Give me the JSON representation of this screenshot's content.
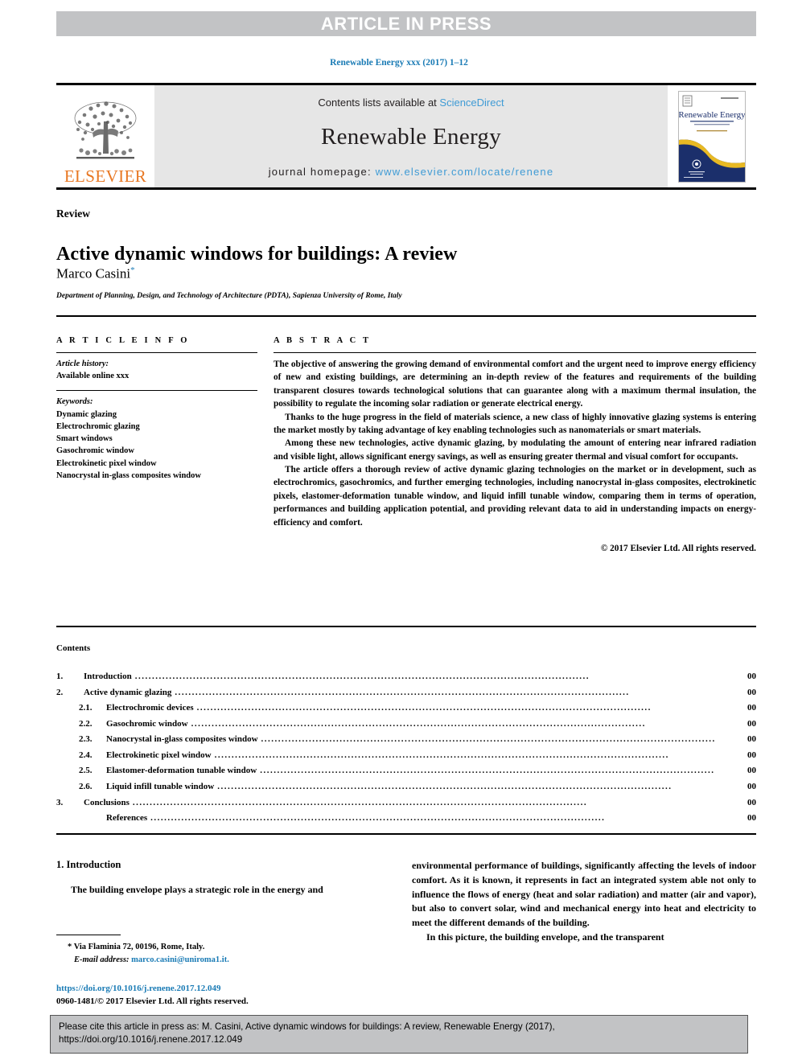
{
  "banner": {
    "text": "ARTICLE IN PRESS"
  },
  "journal_ref": "Renewable Energy xxx (2017) 1–12",
  "masthead": {
    "publisher": "ELSEVIER",
    "contents_prefix": "Contents lists available at ",
    "contents_link": "ScienceDirect",
    "journal_name": "Renewable Energy",
    "homepage_prefix": "journal homepage: ",
    "homepage_url": "www.elsevier.com/locate/renene",
    "cover_title": "Renewable Energy",
    "cover_subtitle": "AN INTERNATIONAL JOURNAL",
    "colors": {
      "elsevier_orange": "#e87722",
      "link_blue": "#3f9bd5",
      "banner_grey": "#c2c3c5",
      "masthead_grey": "#e6e6e6",
      "cover_navy": "#1b2f6b",
      "cover_gold": "#e8b923"
    }
  },
  "article": {
    "type_label": "Review",
    "title": "Active dynamic windows for buildings: A review",
    "author": "Marco Casini",
    "author_marker": "*",
    "affiliation": "Department of Planning, Design, and Technology of Architecture (PDTA), Sapienza University of Rome, Italy"
  },
  "article_info": {
    "heading": "A R T I C L E   I N F O",
    "history_label": "Article history:",
    "history_value": "Available online xxx",
    "keywords_label": "Keywords:",
    "keywords": [
      "Dynamic glazing",
      "Electrochromic glazing",
      "Smart windows",
      "Gasochromic window",
      "Electrokinetic pixel window",
      "Nanocrystal in-glass composites window"
    ]
  },
  "abstract": {
    "heading": "A B S T R A C T",
    "paragraphs": [
      "The objective of answering the growing demand of environmental comfort and the urgent need to improve energy efficiency of new and existing buildings, are determining an in-depth review of the features and requirements of the building transparent closures towards technological solutions that can guarantee along with a maximum thermal insulation, the possibility to regulate the incoming solar radiation or generate electrical energy.",
      "Thanks to the huge progress in the field of materials science, a new class of highly innovative glazing systems is entering the market mostly by taking advantage of key enabling technologies such as nanomaterials or smart materials.",
      "Among these new technologies, active dynamic glazing, by modulating the amount of entering near infrared radiation and visible light, allows significant energy savings, as well as ensuring greater thermal and visual comfort for occupants.",
      "The article offers a thorough review of active dynamic glazing technologies on the market or in development, such as electrochromics, gasochromics, and further emerging technologies, including nanocrystal in-glass composites, electrokinetic pixels, elastomer-deformation tunable window, and liquid infill tunable window, comparing them in terms of operation, performances and building application potential, and providing relevant data to aid in understanding impacts on energy-efficiency and comfort."
    ],
    "copyright": "© 2017 Elsevier Ltd. All rights reserved."
  },
  "contents": {
    "heading": "Contents",
    "entries": [
      {
        "number": "1.",
        "label": "Introduction",
        "page": "00",
        "level": 1
      },
      {
        "number": "2.",
        "label": "Active dynamic glazing",
        "page": "00",
        "level": 1
      },
      {
        "number": "2.1.",
        "label": "Electrochromic devices",
        "page": "00",
        "level": 2
      },
      {
        "number": "2.2.",
        "label": "Gasochromic window",
        "page": "00",
        "level": 2
      },
      {
        "number": "2.3.",
        "label": "Nanocrystal in-glass composites window",
        "page": "00",
        "level": 2
      },
      {
        "number": "2.4.",
        "label": "Electrokinetic pixel window",
        "page": "00",
        "level": 2
      },
      {
        "number": "2.5.",
        "label": "Elastomer-deformation tunable window",
        "page": "00",
        "level": 2
      },
      {
        "number": "2.6.",
        "label": "Liquid infill tunable window",
        "page": "00",
        "level": 2
      },
      {
        "number": "3.",
        "label": "Conclusions",
        "page": "00",
        "level": 1
      },
      {
        "number": "",
        "label": "References",
        "page": "00",
        "level": 2
      }
    ]
  },
  "body": {
    "section_heading": "1.  Introduction",
    "left_column": "The building envelope plays a strategic role in the energy and",
    "right_column_1": "environmental performance of buildings, significantly affecting the levels of indoor comfort. As it is known, it represents in fact an integrated system able not only to influence the flows of energy (heat and solar radiation) and matter (air and vapor), but also to convert solar, wind and mechanical energy into heat and electricity to meet the different demands of the building.",
    "right_column_2": "In this picture, the building envelope, and the transparent"
  },
  "footnote": {
    "marker": "*",
    "address": "Via Flaminia 72, 00196, Rome, Italy.",
    "email_label": "E-mail address:",
    "email": "marco.casini@uniroma1.it.",
    "doi": "https://doi.org/10.1016/j.renene.2017.12.049",
    "issn_line": "0960-1481/© 2017 Elsevier Ltd. All rights reserved."
  },
  "cite_box": {
    "text": "Please cite this article in press as: M. Casini, Active dynamic windows for buildings: A review, Renewable Energy (2017), https://doi.org/10.1016/j.renene.2017.12.049"
  }
}
